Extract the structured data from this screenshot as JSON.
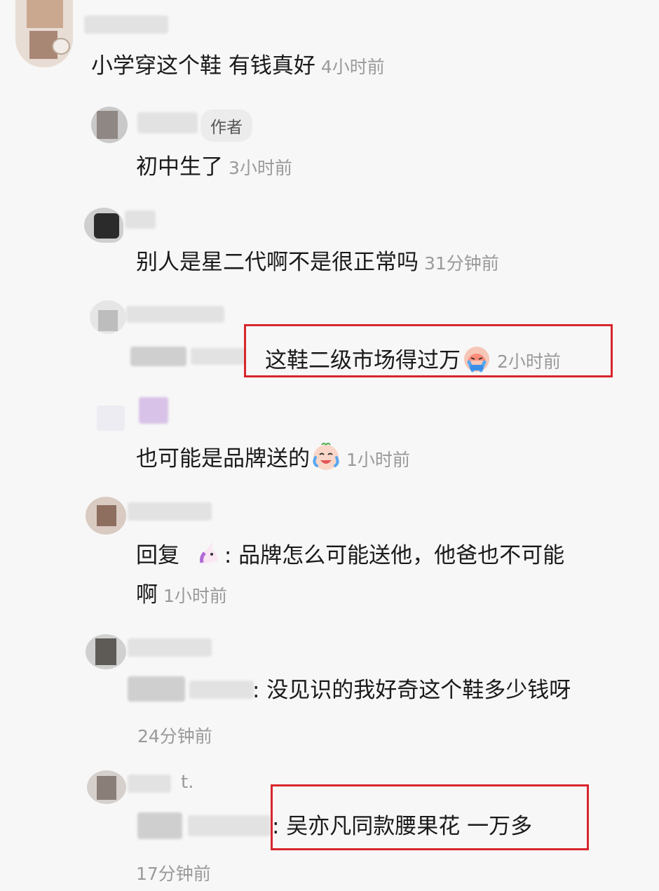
{
  "comments": [
    {
      "text": "小学穿这个鞋 有钱真好",
      "time": "4小时前"
    },
    {
      "author_badge": "作者",
      "text": "初中生了",
      "time": "3小时前"
    },
    {
      "text": "别人是星二代啊不是很正常吗",
      "time": "31分钟前"
    },
    {
      "text": "这鞋二级市场得过万",
      "time": "2小时前"
    },
    {
      "text": "也可能是品牌送的",
      "time": "1小时前"
    },
    {
      "reply_prefix": "回复",
      "text_line1": ": 品牌怎么可能送他，他爸也不可能",
      "text_line2": "啊",
      "time": "1小时前"
    },
    {
      "text": ": 没见识的我好奇这个鞋多少钱呀",
      "time": "24分钟前"
    },
    {
      "name_fragment": "t.",
      "text": ": 吴亦凡同款腰果花 一万多",
      "time": "17分钟前"
    }
  ],
  "icons": {
    "crying_emoji": "crying-face-emoji",
    "laughing_emoji": "laugh-cry-emoji",
    "unicorn_emoji": "unicorn-emoji"
  },
  "colors": {
    "highlight": "#d8262d",
    "time": "#9a9a9a",
    "text": "#1a1a1a"
  }
}
